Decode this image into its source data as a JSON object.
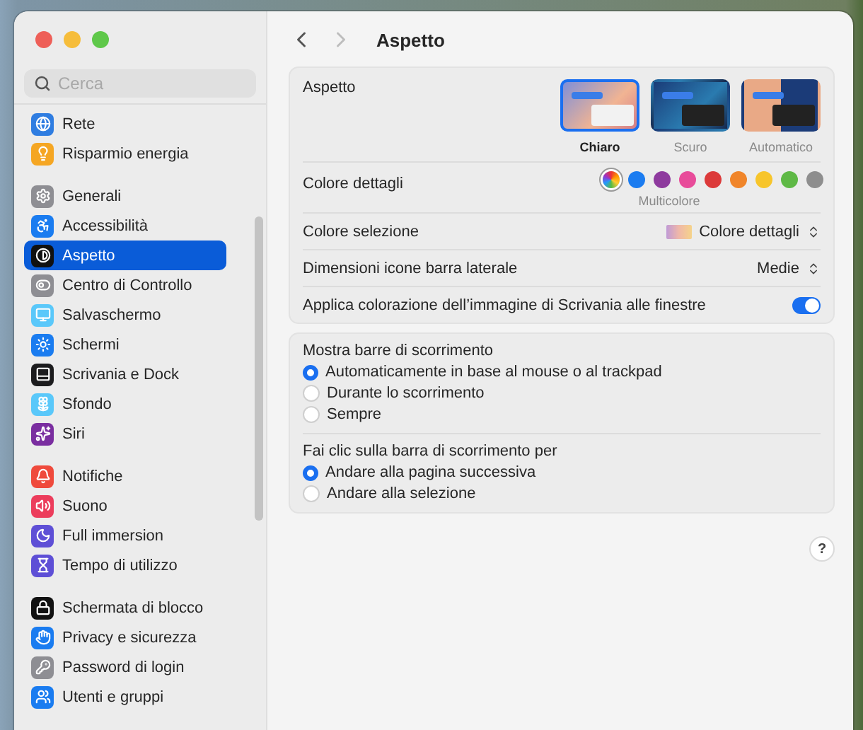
{
  "window": {
    "title": "Aspetto",
    "back_enabled": true,
    "forward_enabled": false
  },
  "search": {
    "placeholder": "Cerca"
  },
  "sidebar": {
    "groups": [
      [
        {
          "label": "Rete",
          "kind": "globe",
          "color": "#2f7de1",
          "selected": false
        },
        {
          "label": "Risparmio energia",
          "kind": "bulb",
          "color": "#f5a623",
          "selected": false
        }
      ],
      [
        {
          "label": "Generali",
          "kind": "gear",
          "color": "#8e8e93",
          "selected": false
        },
        {
          "label": "Accessibilità",
          "kind": "accessibility",
          "color": "#1a7cf0",
          "selected": false
        },
        {
          "label": "Aspetto",
          "kind": "contrast",
          "color": "#111111",
          "selected": true
        },
        {
          "label": "Centro di Controllo",
          "kind": "toggles",
          "color": "#8e8e93",
          "selected": false
        },
        {
          "label": "Salvaschermo",
          "kind": "monitor",
          "color": "#5ac8fa",
          "selected": false
        },
        {
          "label": "Schermi",
          "kind": "sun",
          "color": "#1a7cf0",
          "selected": false
        },
        {
          "label": "Scrivania e Dock",
          "kind": "dock",
          "color": "#1c1c1e",
          "selected": false
        },
        {
          "label": "Sfondo",
          "kind": "flower",
          "color": "#5ac8fa",
          "selected": false
        },
        {
          "label": "Siri",
          "kind": "sparkles",
          "color": "#7a2ea0",
          "selected": false
        }
      ],
      [
        {
          "label": "Notifiche",
          "kind": "bell",
          "color": "#ef4a3c",
          "selected": false
        },
        {
          "label": "Suono",
          "kind": "speaker",
          "color": "#ec3d5c",
          "selected": false
        },
        {
          "label": "Full immersion",
          "kind": "moon",
          "color": "#5e4fd6",
          "selected": false
        },
        {
          "label": "Tempo di utilizzo",
          "kind": "hourglass",
          "color": "#5e4fd6",
          "selected": false
        }
      ],
      [
        {
          "label": "Schermata di blocco",
          "kind": "lock",
          "color": "#111111",
          "selected": false
        },
        {
          "label": "Privacy e sicurezza",
          "kind": "hand",
          "color": "#1a7cf0",
          "selected": false
        },
        {
          "label": "Password di login",
          "kind": "key",
          "color": "#8e8e93",
          "selected": false
        },
        {
          "label": "Utenti e gruppi",
          "kind": "users",
          "color": "#1a7cf0",
          "selected": false
        }
      ]
    ]
  },
  "appearance": {
    "label": "Aspetto",
    "options": [
      {
        "label": "Chiaro",
        "kind": "light",
        "selected": true
      },
      {
        "label": "Scuro",
        "kind": "dark",
        "selected": false
      },
      {
        "label": "Automatico",
        "kind": "auto",
        "selected": false
      }
    ]
  },
  "accent": {
    "label": "Colore dettagli",
    "selected_name": "Multicolore",
    "swatches": [
      {
        "kind": "multi",
        "selected": true
      },
      {
        "kind": "solid",
        "color": "#1b7cf0",
        "selected": false
      },
      {
        "kind": "solid",
        "color": "#8e3a9e",
        "selected": false
      },
      {
        "kind": "solid",
        "color": "#e84c9a",
        "selected": false
      },
      {
        "kind": "solid",
        "color": "#dc3a3a",
        "selected": false
      },
      {
        "kind": "solid",
        "color": "#f0852a",
        "selected": false
      },
      {
        "kind": "solid",
        "color": "#f7c52b",
        "selected": false
      },
      {
        "kind": "solid",
        "color": "#5fb946",
        "selected": false
      },
      {
        "kind": "solid",
        "color": "#8e8e8e",
        "selected": false
      }
    ]
  },
  "highlight": {
    "label": "Colore selezione",
    "value": "Colore dettagli"
  },
  "sidebar_icon_size": {
    "label": "Dimensioni icone barra laterale",
    "value": "Medie"
  },
  "wallpaper_tinting": {
    "label": "Applica colorazione dell’immagine di Scrivania alle finestre",
    "on": true
  },
  "scroll_groups": [
    {
      "title": "Mostra barre di scorrimento",
      "options": [
        {
          "label": "Automaticamente in base al mouse o al trackpad",
          "selected": true
        },
        {
          "label": "Durante lo scorrimento",
          "selected": false
        },
        {
          "label": "Sempre",
          "selected": false
        }
      ]
    },
    {
      "title": "Fai clic sulla barra di scorrimento per",
      "options": [
        {
          "label": "Andare alla pagina successiva",
          "selected": true
        },
        {
          "label": "Andare alla selezione",
          "selected": false
        }
      ]
    }
  ],
  "help": {
    "label": "?"
  }
}
